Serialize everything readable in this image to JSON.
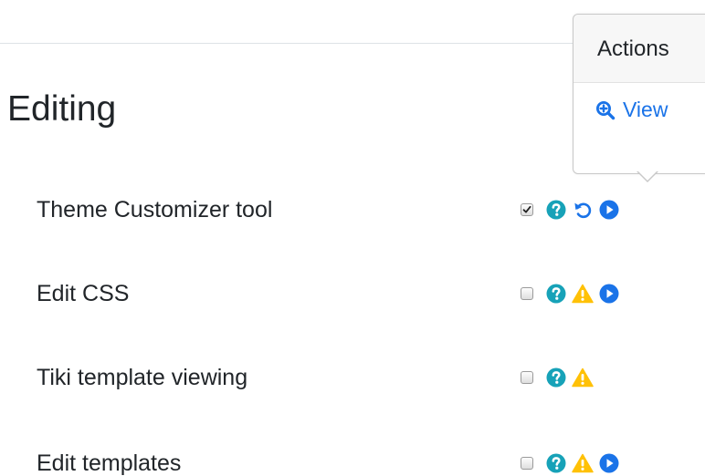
{
  "section": {
    "title": "Editing"
  },
  "features": [
    {
      "label": "Theme Customizer tool",
      "checked": true,
      "icons": [
        "help-icon",
        "undo-icon",
        "play-icon"
      ]
    },
    {
      "label": "Edit CSS",
      "checked": false,
      "icons": [
        "help-icon",
        "warning-icon",
        "play-icon"
      ]
    },
    {
      "label": "Tiki template viewing",
      "checked": false,
      "icons": [
        "help-icon",
        "warning-icon"
      ]
    },
    {
      "label": "Edit templates",
      "checked": false,
      "icons": [
        "help-icon",
        "warning-icon",
        "play-icon"
      ]
    }
  ],
  "popover": {
    "title": "Actions",
    "view_label": "View"
  },
  "colors": {
    "help": "#17a2b8",
    "warning": "#ffc107",
    "primary": "#1a73e8",
    "text": "#212529"
  }
}
